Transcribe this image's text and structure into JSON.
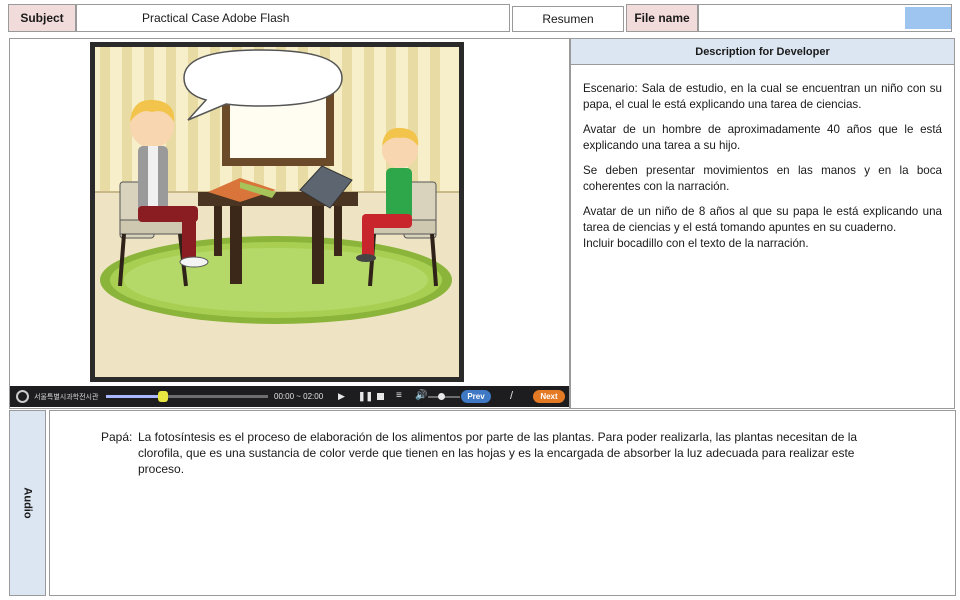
{
  "header": {
    "subject_label": "Subject",
    "subject_value": "Practical Case Adobe Flash",
    "summary_button": "Resumen",
    "file_name_label": "File name",
    "file_name_value": ""
  },
  "description": {
    "title": "Description for Developer",
    "paragraphs": [
      "Escenario: Sala de estudio, en la cual se encuentran un niño con su papa, el cual le está explicando una tarea de ciencias.",
      "Avatar de un hombre de aproximadamente 40 años que le está explicando una tarea a su hijo.",
      "Se deben presentar movimientos en las manos y en la boca coherentes con la narración.",
      "Avatar de un niño de 8 años  al que su papa le está explicando una tarea de ciencias y el está tomando apuntes en su cuaderno.",
      "Incluir bocadillo con el texto de la narración."
    ]
  },
  "player": {
    "logo_text": "서울특별시과학전시관",
    "time": "00:00 ~ 02:00",
    "prev_label": "Prev",
    "slash": "/",
    "next_label": "Next",
    "progress": 0.35,
    "volume": 0.4
  },
  "audio": {
    "tab_label": "Audio",
    "speaker": "Papá:",
    "text": "La fotosíntesis es el proceso de elaboración de los alimentos por parte de las plantas. Para poder realizarla,  las plantas necesitan de la clorofila, que es una sustancia de color verde que tienen en las hojas y es la encargada de absorber la luz adecuada para realizar este proceso."
  },
  "colors": {
    "label_pink": "#f2dcdb",
    "label_blue": "#dce6f2",
    "accent_box": "#9ec5f0",
    "prev_blue": "#3f78c5",
    "next_orange": "#e57a24"
  }
}
